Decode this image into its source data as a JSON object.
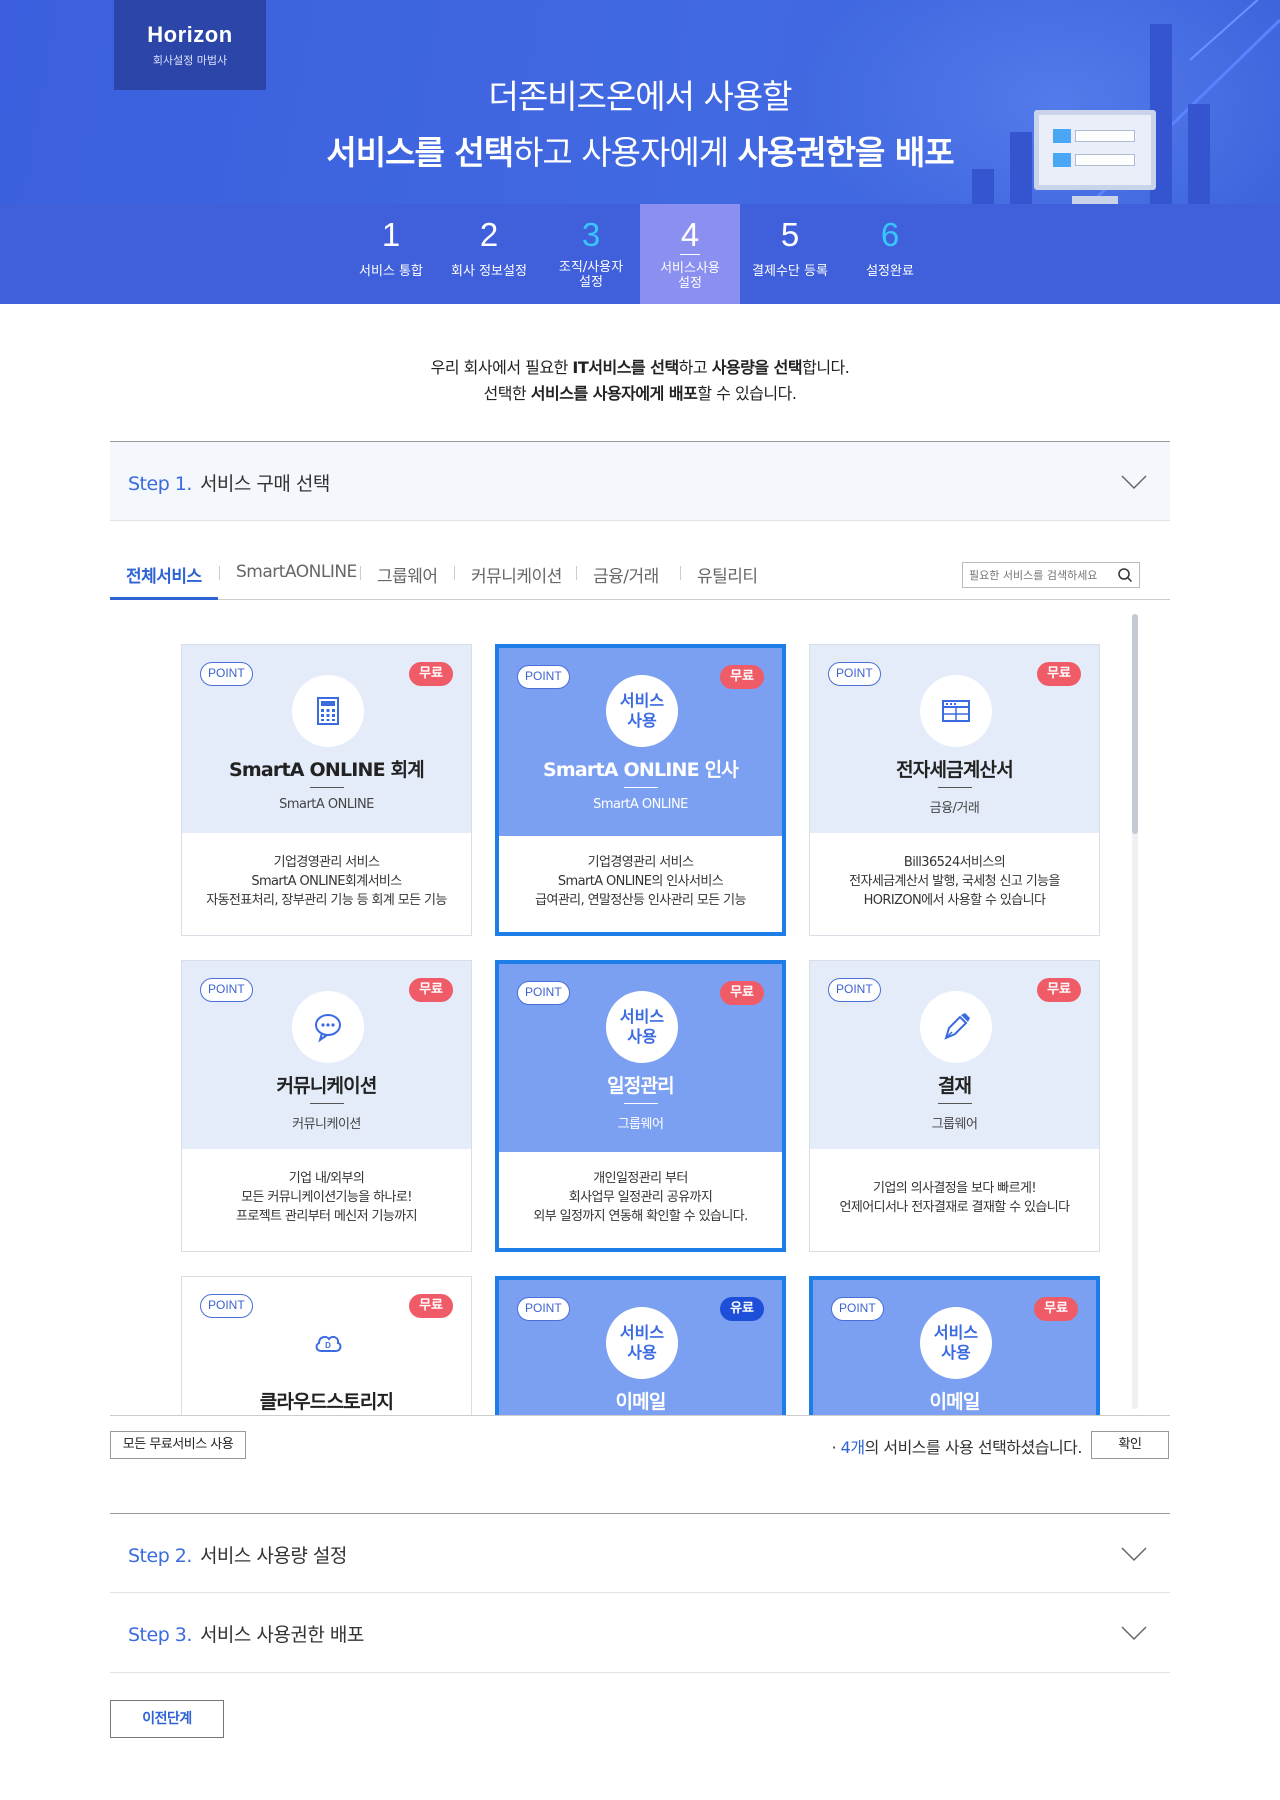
{
  "brand": {
    "title": "Horizon",
    "subtitle": "회사설정 마법사"
  },
  "hero": {
    "line1": "더존비즈온에서 사용할",
    "line2_a": "서비스를 선택",
    "line2_b": "하고 사용자에게 ",
    "line2_c": "사용권한을 배포"
  },
  "steps": [
    {
      "num": "1",
      "label": "서비스 통합"
    },
    {
      "num": "2",
      "label": "회사 정보설정"
    },
    {
      "num": "3",
      "label": "조직/사용자 설정"
    },
    {
      "num": "4",
      "label": "서비스사용 설정"
    },
    {
      "num": "5",
      "label": "결제수단 등록"
    },
    {
      "num": "6",
      "label": "설정완료"
    }
  ],
  "active_step": "4",
  "intro": {
    "l1_a": "우리 회사에서 필요한 ",
    "l1_b": "IT서비스를 선택",
    "l1_c": "하고 ",
    "l1_d": "사용량을 선택",
    "l1_e": "합니다.",
    "l2_a": "선택한 ",
    "l2_b": "서비스를 사용자에게 배포",
    "l2_c": "할 수 있습니다."
  },
  "step1": {
    "step_label": "Step 1.",
    "title": "서비스 구매 선택"
  },
  "tabs": [
    "전체서비스",
    "SmartAONLINE",
    "그룹웨어",
    "커뮤니케이션",
    "금융/거래",
    "유틸리티"
  ],
  "active_tab": "전체서비스",
  "search": {
    "placeholder": "필요한 서비스를 검색하세요"
  },
  "point_label": "POINT",
  "use_label_1": "서비스",
  "use_label_2": "사용",
  "cards": [
    {
      "name": "SmartA ONLINE 회계",
      "category": "SmartA ONLINE",
      "badge": "무료",
      "selected": false,
      "icon": "calculator-icon",
      "desc": [
        "기업경영관리 서비스",
        "SmartA ONLINE회계서비스",
        "자동전표처리, 장부관리 기능 등 회계 모든 기능"
      ]
    },
    {
      "name": "SmartA ONLINE 인사",
      "category": "SmartA ONLINE",
      "badge": "무료",
      "selected": true,
      "icon": "service-use",
      "desc": [
        "기업경영관리 서비스",
        "SmartA ONLINE의 인사서비스",
        "급여관리, 연말정산등 인사관리 모든 기능"
      ]
    },
    {
      "name": "전자세금계산서",
      "category": "금융/거래",
      "badge": "무료",
      "selected": false,
      "icon": "invoice-icon",
      "desc": [
        "Bill36524서비스의",
        "전자세금계산서 발행, 국세청 신고 기능을",
        "HORIZON에서 사용할 수 있습니다"
      ]
    },
    {
      "name": "커뮤니케이션",
      "category": "커뮤니케이션",
      "badge": "무료",
      "selected": false,
      "icon": "chat-icon",
      "desc": [
        "기업 내/외부의",
        "모든 커뮤니케이션기능을 하나로!",
        "프로젝트 관리부터 메신저 기능까지"
      ]
    },
    {
      "name": "일정관리",
      "category": "그룹웨어",
      "badge": "무료",
      "selected": true,
      "icon": "service-use",
      "desc": [
        "개인일정관리 부터",
        "회사업무 일정관리 공유까지",
        "외부 일정까지 연동해 확인할 수 있습니다."
      ]
    },
    {
      "name": "결재",
      "category": "그룹웨어",
      "badge": "무료",
      "selected": false,
      "icon": "pen-icon",
      "desc": [
        "기업의 의사결정을 보다 빠르게!",
        "언제어디서나 전자결재로 결재할 수 있습니다"
      ]
    },
    {
      "name": "클라우드스토리지",
      "category": "",
      "badge": "무료",
      "selected": false,
      "icon": "cloud-icon",
      "desc": []
    },
    {
      "name": "이메일",
      "category": "",
      "badge": "유료",
      "selected": true,
      "icon": "service-use",
      "desc": []
    },
    {
      "name": "이메일",
      "category": "",
      "badge": "무료",
      "selected": true,
      "icon": "service-use",
      "desc": []
    }
  ],
  "footer": {
    "all_free_label": "모든 무료서비스 사용",
    "msg_prefix": "· ",
    "count": "4개",
    "msg_suffix": "의 서비스를 사용 선택하셨습니다.",
    "confirm_label": "확인"
  },
  "step2": {
    "step_label": "Step 2.",
    "title": "서비스 사용량 설정"
  },
  "step3": {
    "step_label": "Step 3.",
    "title": "서비스 사용권한 배포"
  },
  "prev_label": "이전단계",
  "colors": {
    "hero": "#4169e1",
    "nav": "#3f5fdb",
    "active_step": "#8a8ff0",
    "accent": "#2e63d6",
    "badge_free": "#f05b68",
    "badge_paid": "#1d4fd8",
    "card_selected": "#7ba0f2"
  }
}
